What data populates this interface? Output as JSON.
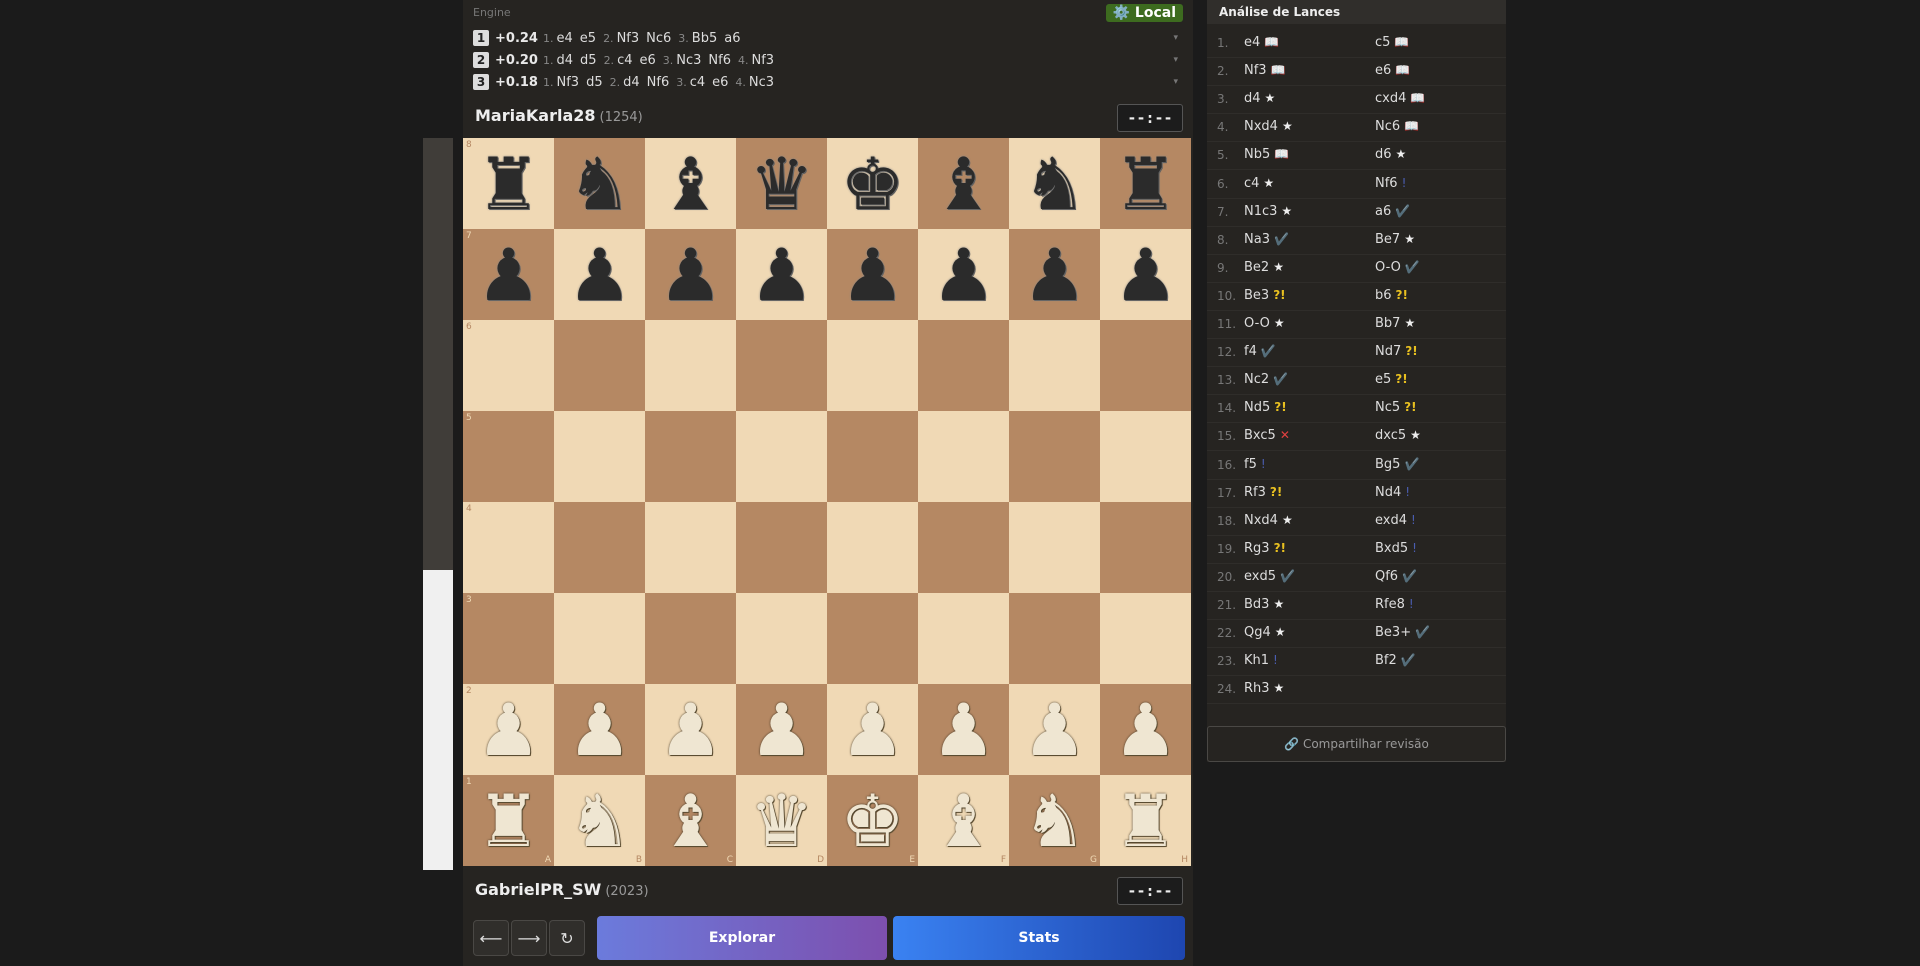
{
  "eval": {
    "white_fraction": 0.41
  },
  "engine": {
    "label": "Engine",
    "mode": "⚙️ Local",
    "lines": [
      {
        "rank": "1",
        "score": "+0.24",
        "moves": [
          [
            "1.",
            "e4"
          ],
          [
            "",
            "e5"
          ],
          [
            "2.",
            "Nf3"
          ],
          [
            "",
            "Nc6"
          ],
          [
            "3.",
            "Bb5"
          ],
          [
            "",
            "a6"
          ]
        ]
      },
      {
        "rank": "2",
        "score": "+0.20",
        "moves": [
          [
            "1.",
            "d4"
          ],
          [
            "",
            "d5"
          ],
          [
            "2.",
            "c4"
          ],
          [
            "",
            "e6"
          ],
          [
            "3.",
            "Nc3"
          ],
          [
            "",
            "Nf6"
          ],
          [
            "4.",
            "Nf3"
          ]
        ]
      },
      {
        "rank": "3",
        "score": "+0.18",
        "moves": [
          [
            "1.",
            "Nf3"
          ],
          [
            "",
            "d5"
          ],
          [
            "2.",
            "d4"
          ],
          [
            "",
            "Nf6"
          ],
          [
            "3.",
            "c4"
          ],
          [
            "",
            "e6"
          ],
          [
            "4.",
            "Nc3"
          ]
        ]
      }
    ],
    "expand_icon": "▾"
  },
  "top_player": {
    "name": "MariaKarla28",
    "rating": "(1254)",
    "clock": "--:--"
  },
  "bottom_player": {
    "name": "GabrielPR_SW",
    "rating": "(2023)",
    "clock": "--:--"
  },
  "board": {
    "ranks": [
      "8",
      "7",
      "6",
      "5",
      "4",
      "3",
      "2",
      "1"
    ],
    "files": [
      "A",
      "B",
      "C",
      "D",
      "E",
      "F",
      "G",
      "H"
    ],
    "position": [
      [
        "br",
        "bn",
        "bb",
        "bq",
        "bk",
        "bb",
        "bn",
        "br"
      ],
      [
        "bp",
        "bp",
        "bp",
        "bp",
        "bp",
        "bp",
        "bp",
        "bp"
      ],
      [
        "",
        "",
        "",
        "",
        "",
        "",
        "",
        ""
      ],
      [
        "",
        "",
        "",
        "",
        "",
        "",
        "",
        ""
      ],
      [
        "",
        "",
        "",
        "",
        "",
        "",
        "",
        ""
      ],
      [
        "",
        "",
        "",
        "",
        "",
        "",
        "",
        ""
      ],
      [
        "wp",
        "wp",
        "wp",
        "wp",
        "wp",
        "wp",
        "wp",
        "wp"
      ],
      [
        "wr",
        "wn",
        "wb",
        "wq",
        "wk",
        "wb",
        "wn",
        "wr"
      ]
    ]
  },
  "controls": {
    "prev": "⟵",
    "next": "⟶",
    "flip": "↻",
    "explore": "Explorar",
    "stats": "Stats"
  },
  "analysis": {
    "title": "Análise de Lances",
    "moves": [
      {
        "n": "1.",
        "w": "e4",
        "wa": "book",
        "b": "c5",
        "ba": "book"
      },
      {
        "n": "2.",
        "w": "Nf3",
        "wa": "book",
        "b": "e6",
        "ba": "book"
      },
      {
        "n": "3.",
        "w": "d4",
        "wa": "star",
        "b": "cxd4",
        "ba": "book"
      },
      {
        "n": "4.",
        "w": "Nxd4",
        "wa": "star",
        "b": "Nc6",
        "ba": "book"
      },
      {
        "n": "5.",
        "w": "Nb5",
        "wa": "book",
        "b": "d6",
        "ba": "star"
      },
      {
        "n": "6.",
        "w": "c4",
        "wa": "star",
        "b": "Nf6",
        "ba": "ok"
      },
      {
        "n": "7.",
        "w": "N1c3",
        "wa": "star",
        "b": "a6",
        "ba": "good"
      },
      {
        "n": "8.",
        "w": "Na3",
        "wa": "good",
        "b": "Be7",
        "ba": "star"
      },
      {
        "n": "9.",
        "w": "Be2",
        "wa": "star",
        "b": "O-O",
        "ba": "good"
      },
      {
        "n": "10.",
        "w": "Be3",
        "wa": "dubious",
        "b": "b6",
        "ba": "dubious"
      },
      {
        "n": "11.",
        "w": "O-O",
        "wa": "star",
        "b": "Bb7",
        "ba": "star"
      },
      {
        "n": "12.",
        "w": "f4",
        "wa": "good",
        "b": "Nd7",
        "ba": "dubious"
      },
      {
        "n": "13.",
        "w": "Nc2",
        "wa": "good",
        "b": "e5",
        "ba": "dubious"
      },
      {
        "n": "14.",
        "w": "Nd5",
        "wa": "dubious",
        "b": "Nc5",
        "ba": "dubious"
      },
      {
        "n": "15.",
        "w": "Bxc5",
        "wa": "blunder",
        "b": "dxc5",
        "ba": "star"
      },
      {
        "n": "16.",
        "w": "f5",
        "wa": "ok",
        "b": "Bg5",
        "ba": "good"
      },
      {
        "n": "17.",
        "w": "Rf3",
        "wa": "dubious",
        "b": "Nd4",
        "ba": "ok"
      },
      {
        "n": "18.",
        "w": "Nxd4",
        "wa": "star",
        "b": "exd4",
        "ba": "ok"
      },
      {
        "n": "19.",
        "w": "Rg3",
        "wa": "dubious",
        "b": "Bxd5",
        "ba": "ok"
      },
      {
        "n": "20.",
        "w": "exd5",
        "wa": "good",
        "b": "Qf6",
        "ba": "good"
      },
      {
        "n": "21.",
        "w": "Bd3",
        "wa": "star",
        "b": "Rfe8",
        "ba": "ok"
      },
      {
        "n": "22.",
        "w": "Qg4",
        "wa": "star",
        "b": "Be3+",
        "ba": "good"
      },
      {
        "n": "23.",
        "w": "Kh1",
        "wa": "ok",
        "b": "Bf2",
        "ba": "good"
      },
      {
        "n": "24.",
        "w": "Rh3",
        "wa": "star",
        "b": "",
        "ba": ""
      }
    ],
    "annotation_glyphs": {
      "book": "📖",
      "star": "★",
      "good": "✔️",
      "ok": "!",
      "dubious": "?!",
      "blunder": "✕"
    },
    "share": "🔗 Compartilhar revisão"
  }
}
